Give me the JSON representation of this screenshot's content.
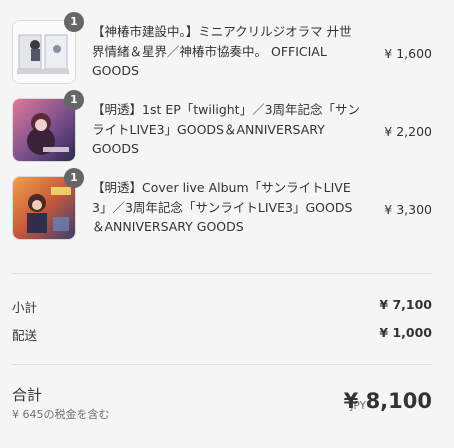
{
  "cart": {
    "items": [
      {
        "quantity": "1",
        "name": "【神椿市建設中。】ミニアクリルジオラマ 廾世界情緒＆星界／神椿市協奏中。 OFFICIAL GOODS",
        "price": "¥ 1,600",
        "thumb_icon": "acrylic-diorama-thumbnail"
      },
      {
        "quantity": "1",
        "name": "【明透】1st EP「twilight」／3周年記念「サンライトLIVE3」GOODS＆ANNIVERSARY GOODS",
        "price": "¥ 2,200",
        "thumb_icon": "twilight-ep-thumbnail"
      },
      {
        "quantity": "1",
        "name": "【明透】Cover live Album「サンライトLIVE 3」／3周年記念「サンライトLIVE3」GOODS＆ANNIVERSARY GOODS",
        "price": "¥ 3,300",
        "thumb_icon": "cover-live-album-thumbnail"
      }
    ]
  },
  "summary": {
    "subtotal_label": "小計",
    "subtotal_value": "¥ 7,100",
    "shipping_label": "配送",
    "shipping_value": "¥ 1,000",
    "total_label": "合計",
    "tax_note": "¥ 645の税金を含む",
    "currency": "JPY",
    "total_value": "¥ 8,100"
  },
  "colors": {
    "background": "#f5f5f5",
    "badge": "#666666",
    "divider": "#dedede",
    "text": "#333333",
    "muted": "#707070"
  }
}
